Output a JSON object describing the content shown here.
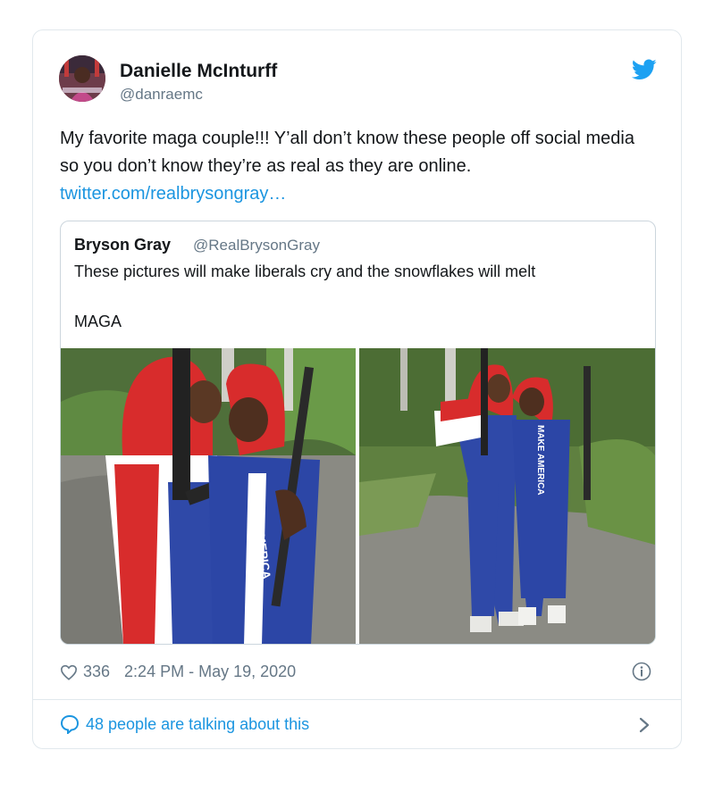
{
  "tweet": {
    "author_name": "Danielle McInturff",
    "author_handle": "@danraemc",
    "text": "My favorite maga couple!!! Y’all don’t know these people off social media so you don’t know they’re as real as they are online.",
    "link": "twitter.com/realbrysongray…",
    "likes": "336",
    "timestamp": "2:24 PM - May 19, 2020",
    "talking": "48 people are talking about this"
  },
  "quoted": {
    "author_name": "Bryson Gray",
    "author_handle": "@RealBrysonGray",
    "text": "These pictures will make liberals cry and the snowflakes will melt",
    "text2": "MAGA",
    "suit_text_left": "MAKE AMERICA",
    "suit_text_right": "MAKE AMERICA"
  },
  "colors": {
    "link_blue": "#1b95e0",
    "twitter_blue": "#1da1f2",
    "secondary_text": "#657786",
    "border": "#e1e8ed"
  },
  "icons": [
    "twitter-bird-icon",
    "heart-icon",
    "info-icon",
    "speech-bubble-icon",
    "chevron-right-icon"
  ]
}
